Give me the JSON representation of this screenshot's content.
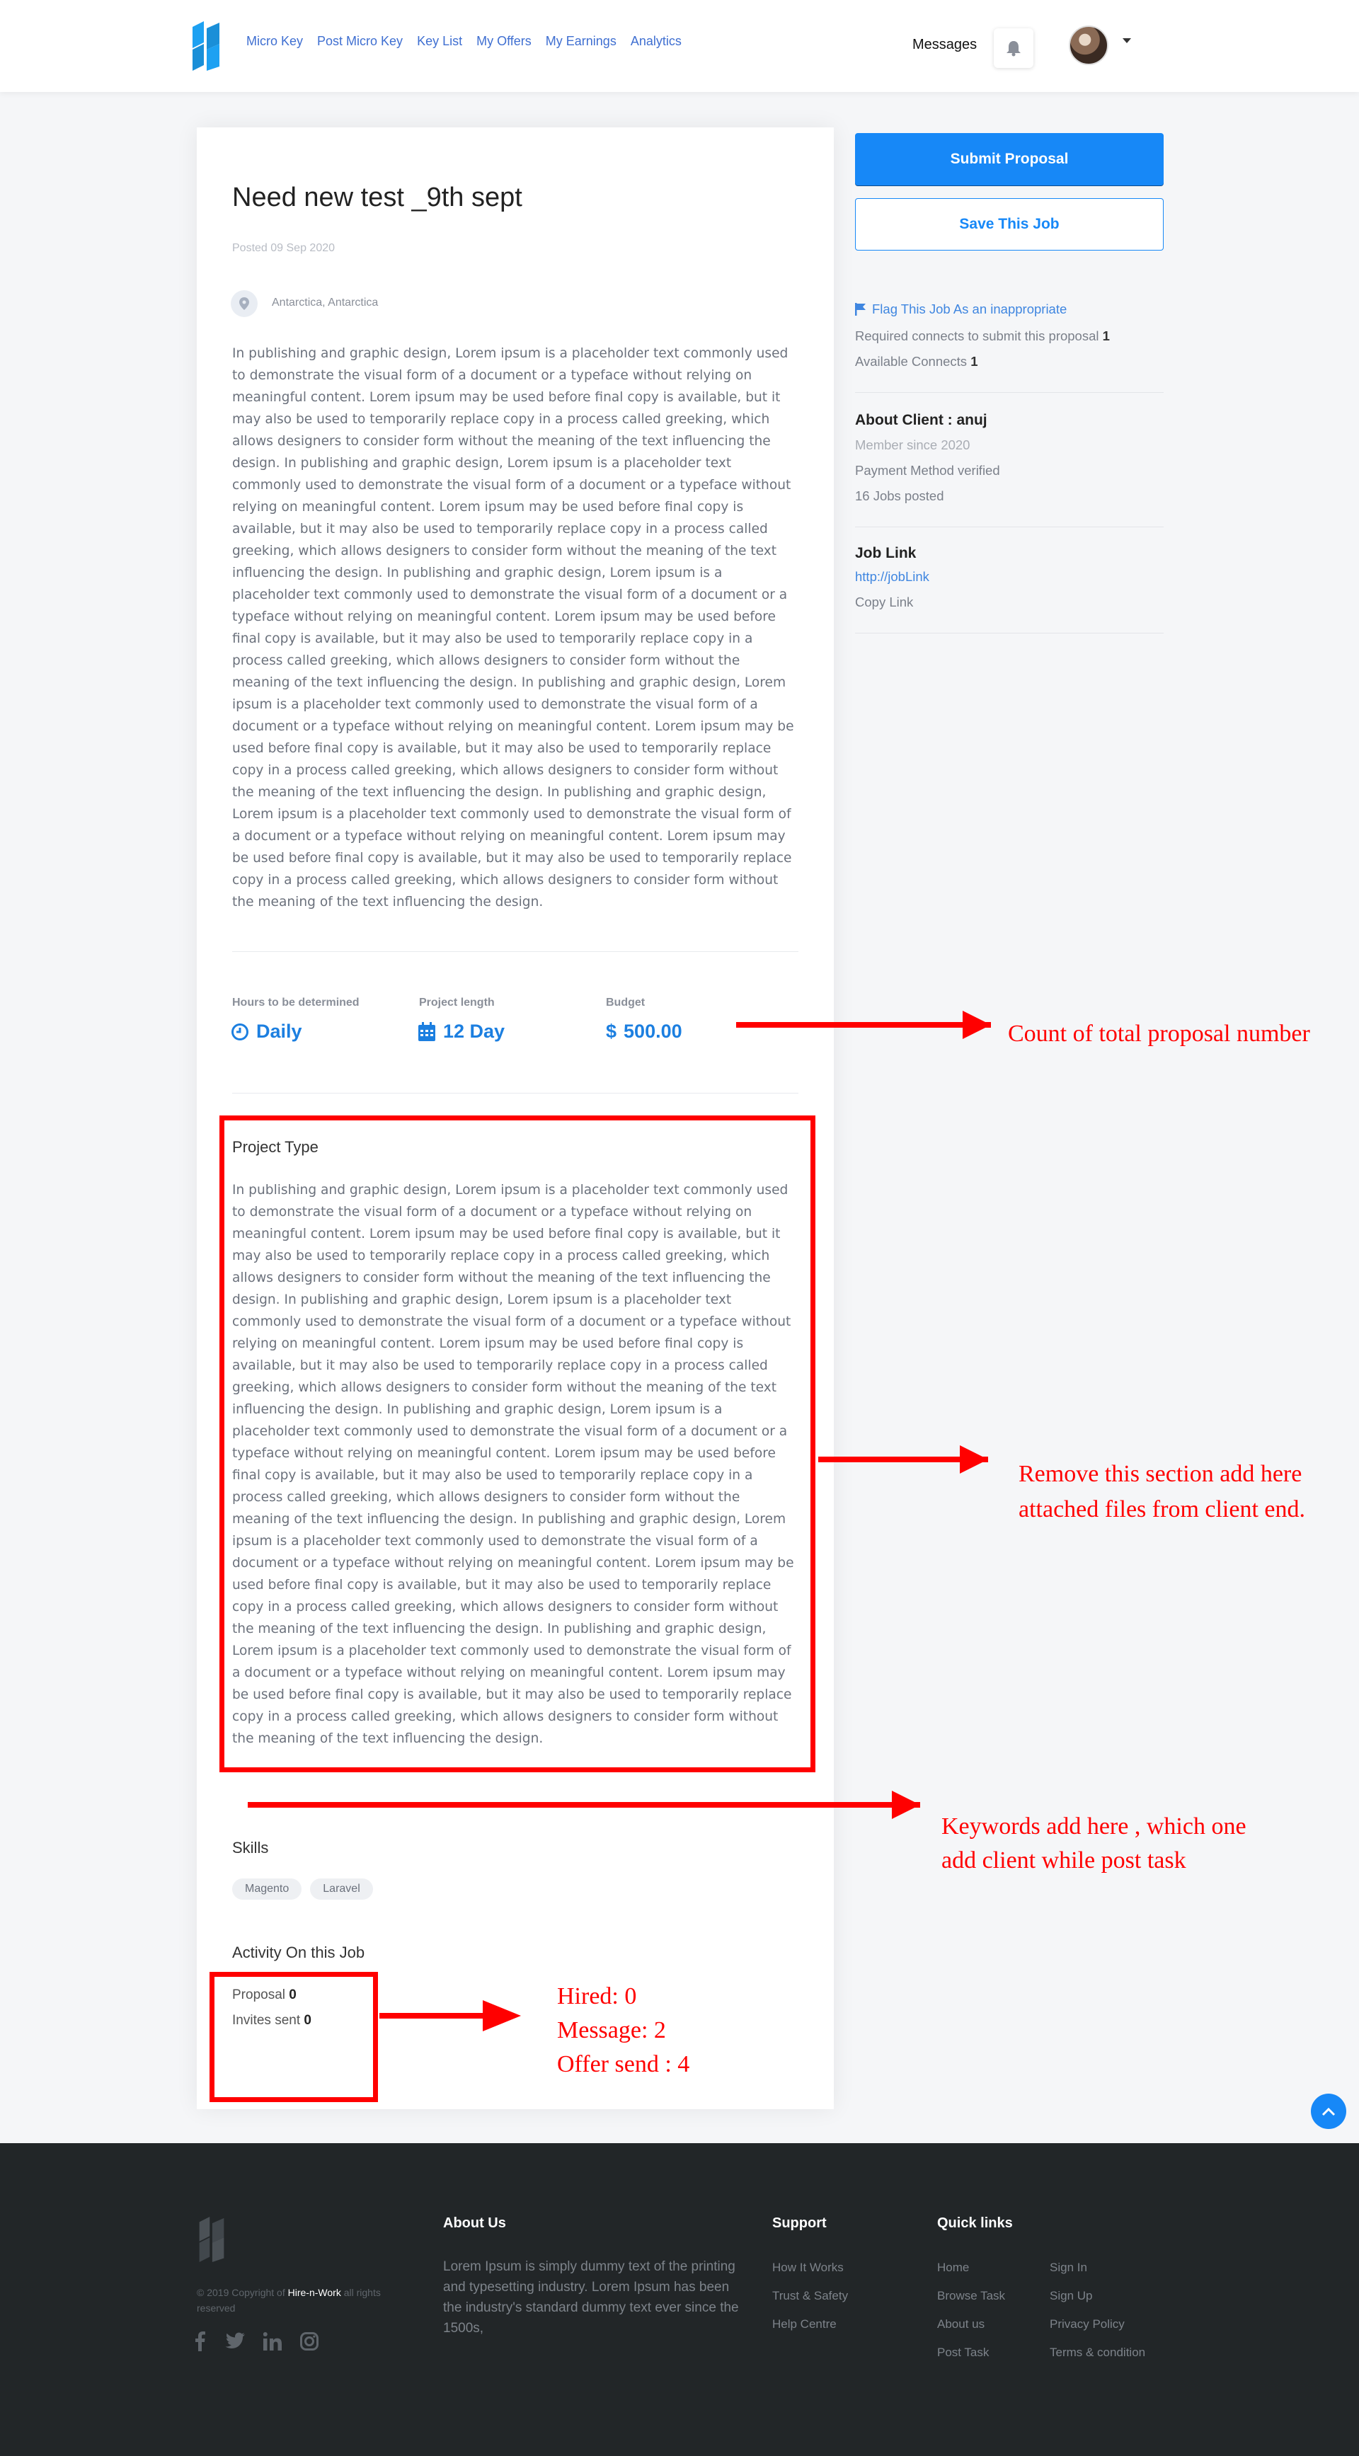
{
  "header": {
    "nav": [
      "Micro Key",
      "Post Micro Key",
      "Key List",
      "My Offers",
      "My Earnings",
      "Analytics"
    ],
    "messages_label": "Messages"
  },
  "job": {
    "title": "Need new test _9th sept",
    "posted": "Posted 09 Sep 2020",
    "location": "Antarctica, Antarctica",
    "description": "In publishing and graphic design, Lorem ipsum is a placeholder text commonly used to demonstrate the visual form of a document or a typeface without relying on meaningful content. Lorem ipsum may be used before final copy is available, but it may also be used to temporarily replace copy in a process called greeking, which allows designers to consider form without the meaning of the text influencing the design. In publishing and graphic design, Lorem ipsum is a placeholder text commonly used to demonstrate the visual form of a document or a typeface without relying on meaningful content. Lorem ipsum may be used before final copy is available, but it may also be used to temporarily replace copy in a process called greeking, which allows designers to consider form without the meaning of the text influencing the design. In publishing and graphic design, Lorem ipsum is a placeholder text commonly used to demonstrate the visual form of a document or a typeface without relying on meaningful content. Lorem ipsum may be used before final copy is available, but it may also be used to temporarily replace copy in a process called greeking, which allows designers to consider form without the meaning of the text influencing the design. In publishing and graphic design, Lorem ipsum is a placeholder text commonly used to demonstrate the visual form of a document or a typeface without relying on meaningful content. Lorem ipsum may be used before final copy is available, but it may also be used to temporarily replace copy in a process called greeking, which allows designers to consider form without the meaning of the text influencing the design. In publishing and graphic design, Lorem ipsum is a placeholder text commonly used to demonstrate the visual form of a document or a typeface without relying on meaningful content. Lorem ipsum may be used before final copy is available, but it may also be used to temporarily replace copy in a process called greeking, which allows designers to consider form without the meaning of the text influencing the design.",
    "metrics": {
      "hours_label": "Hours to be determined",
      "hours_value": "Daily",
      "length_label": "Project length",
      "length_value": "12 Day",
      "budget_label": "Budget",
      "budget_value": "500.00"
    },
    "project_type_title": "Project Type",
    "project_type_text": "In publishing and graphic design, Lorem ipsum is a placeholder text commonly used to demonstrate the visual form of a document or a typeface without relying on meaningful content. Lorem ipsum may be used before final copy is available, but it may also be used to temporarily replace copy in a process called greeking, which allows designers to consider form without the meaning of the text influencing the design. In publishing and graphic design, Lorem ipsum is a placeholder text commonly used to demonstrate the visual form of a document or a typeface without relying on meaningful content. Lorem ipsum may be used before final copy is available, but it may also be used to temporarily replace copy in a process called greeking, which allows designers to consider form without the meaning of the text influencing the design. In publishing and graphic design, Lorem ipsum is a placeholder text commonly used to demonstrate the visual form of a document or a typeface without relying on meaningful content. Lorem ipsum may be used before final copy is available, but it may also be used to temporarily replace copy in a process called greeking, which allows designers to consider form without the meaning of the text influencing the design. In publishing and graphic design, Lorem ipsum is a placeholder text commonly used to demonstrate the visual form of a document or a typeface without relying on meaningful content. Lorem ipsum may be used before final copy is available, but it may also be used to temporarily replace copy in a process called greeking, which allows designers to consider form without the meaning of the text influencing the design. In publishing and graphic design, Lorem ipsum is a placeholder text commonly used to demonstrate the visual form of a document or a typeface without relying on meaningful content. Lorem ipsum may be used before final copy is available, but it may also be used to temporarily replace copy in a process called greeking, which allows designers to consider form without the meaning of the text influencing the design.",
    "skills_title": "Skills",
    "skills": [
      "Magento",
      "Laravel"
    ],
    "activity_title": "Activity On this Job",
    "activity": {
      "proposal_label": "Proposal",
      "proposal_value": "0",
      "invites_label": "Invites sent",
      "invites_value": "0"
    }
  },
  "sidebar": {
    "submit_label": "Submit Proposal",
    "save_label": "Save This Job",
    "flag_label": "Flag This Job As an inappropriate",
    "required_label": "Required connects to submit this proposal",
    "required_value": "1",
    "available_label": "Available Connects",
    "available_value": "1",
    "client_title": "About Client : anuj",
    "member_since": "Member since 2020",
    "payment": "Payment Method verified",
    "jobs_posted": "16 Jobs posted",
    "job_link_title": "Job Link",
    "job_link": "http://jobLink",
    "copy_link": "Copy Link"
  },
  "annotations": {
    "count": "Count of total proposal number",
    "remove_line1": "Remove this section add here",
    "remove_line2": "attached files from client end.",
    "keywords_line1": "Keywords add here , which one",
    "keywords_line2": "add client while post task",
    "hired": "Hired: 0",
    "message": "Message: 2",
    "offer": "Offer send : 4",
    "color": "#ff0000"
  },
  "footer": {
    "copyright_pre": "© 2019 Copyright of",
    "copyright_brand": "Hire-n-Work",
    "copyright_post": "all rights",
    "copyright_line2": "reserved",
    "about_title": "About Us",
    "about_text": "Lorem Ipsum is simply dummy text of the printing and typesetting industry. Lorem Ipsum has been the industry's standard dummy text ever since the 1500s,",
    "support_title": "Support",
    "support_links": [
      "How It Works",
      "Trust & Safety",
      "Help Centre"
    ],
    "quick_title": "Quick links",
    "quick_col1": [
      "Home",
      "Browse Task",
      "About us",
      "Post Task"
    ],
    "quick_col2": [
      "Sign In",
      "Sign Up",
      "Privacy Policy",
      "Terms & condition"
    ]
  },
  "colors": {
    "primary": "#1788f7",
    "footer_bg": "#222628"
  }
}
